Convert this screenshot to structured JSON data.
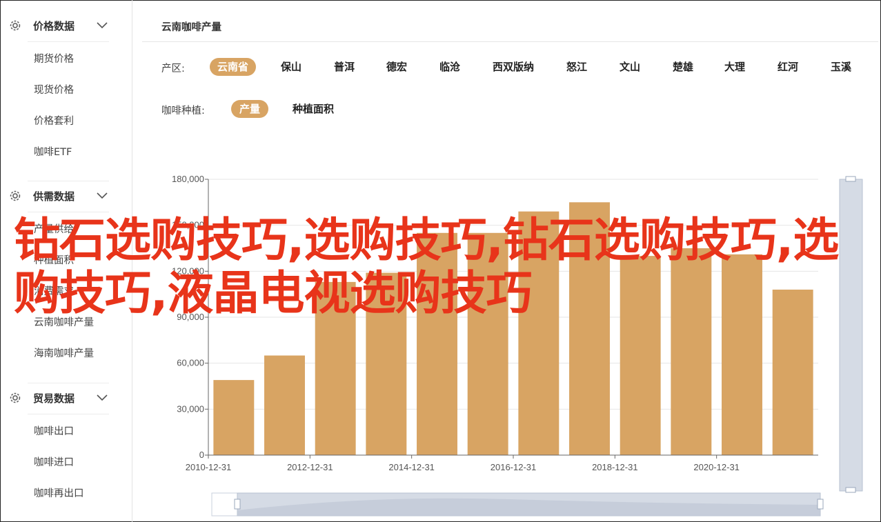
{
  "sidebar": {
    "groups": [
      {
        "title": "价格数据",
        "icon": "gear-icon",
        "items": [
          "期货价格",
          "现货价格",
          "价格套利",
          "咖啡ETF"
        ]
      },
      {
        "title": "供需数据",
        "icon": "gear-icon",
        "items": [
          "产量供给",
          "种植面积",
          "消费需求",
          "云南咖啡产量",
          "海南咖啡产量"
        ]
      },
      {
        "title": "贸易数据",
        "icon": "gear-icon",
        "items": [
          "咖啡出口",
          "咖啡进口",
          "咖啡再出口"
        ]
      }
    ]
  },
  "main": {
    "title": "云南咖啡产量",
    "region_label": "产区:",
    "regions": [
      "云南省",
      "保山",
      "普洱",
      "德宏",
      "临沧",
      "西双版纳",
      "怒江",
      "文山",
      "楚雄",
      "大理",
      "红河",
      "玉溪"
    ],
    "region_selected": "云南省",
    "planting_label": "咖啡种植:",
    "planting_options": [
      "产量",
      "种植面积"
    ],
    "planting_selected": "产量"
  },
  "overlay_text": "钻石选购技巧,选购技巧,钻石选购技巧,选购技巧,液晶电视选购技巧",
  "colors": {
    "bar": "#d8a463",
    "accent": "#d8a463",
    "overlay": "#e8341a",
    "slider": "#d5dbe5"
  },
  "chart_data": {
    "type": "bar",
    "x": [
      "2010-12-31",
      "2011-12-31",
      "2012-12-31",
      "2013-12-31",
      "2014-12-31",
      "2015-12-31",
      "2016-12-31",
      "2017-12-31",
      "2018-12-31",
      "2019-12-31",
      "2020-12-31",
      "2021-12-31"
    ],
    "x_tick_labels": [
      "2010-12-31",
      "2012-12-31",
      "2014-12-31",
      "2016-12-31",
      "2018-12-31",
      "2020-12-31"
    ],
    "values": [
      49000,
      65000,
      113000,
      119000,
      145000,
      145000,
      159000,
      165000,
      130000,
      135000,
      131000,
      108000
    ],
    "ylim": [
      0,
      180000
    ],
    "y_ticks": [
      0,
      30000,
      60000,
      90000,
      120000,
      150000,
      180000
    ],
    "y_tick_labels": [
      "0",
      "30,000",
      "60,000",
      "90,000",
      "120,000",
      "150,000",
      "180,000"
    ],
    "grid": true
  }
}
